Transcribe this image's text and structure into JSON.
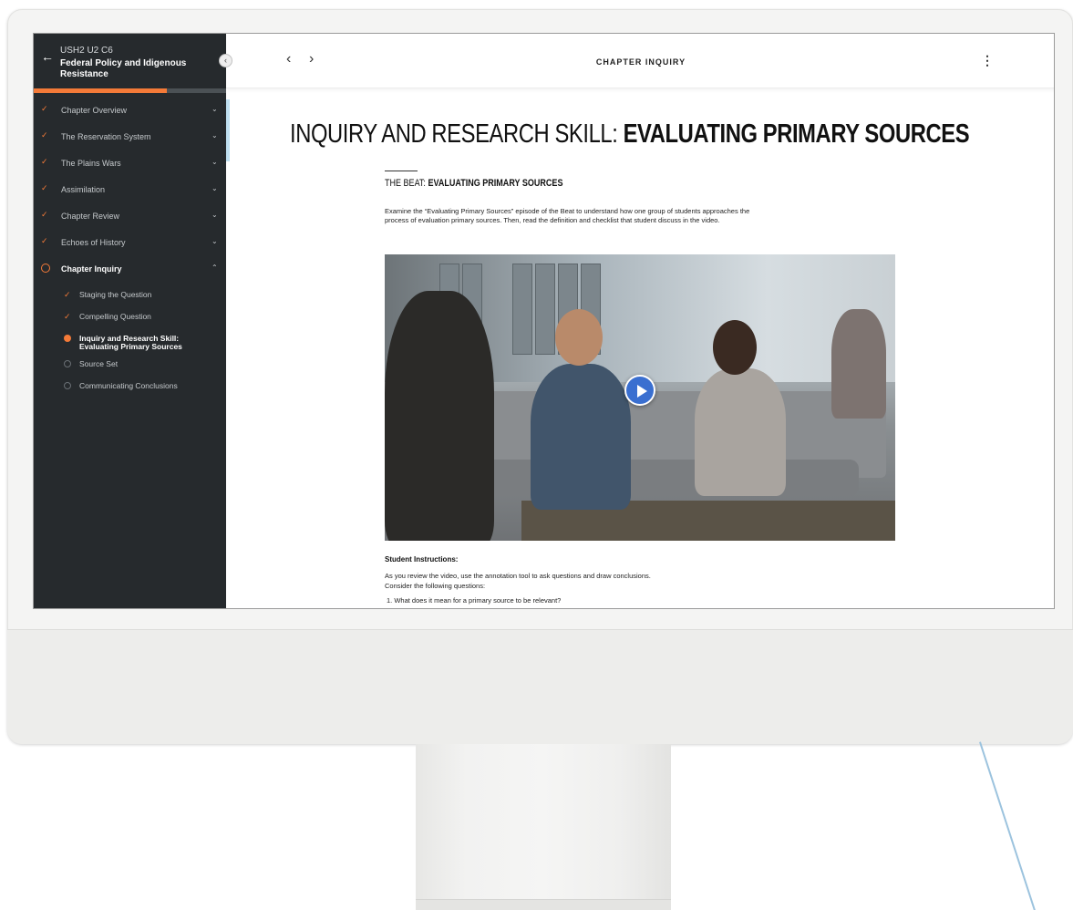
{
  "sidebar": {
    "course_code": "USH2 U2 C6",
    "course_title": "Federal Policy and Idigenous Resistance",
    "progress_percent": 69,
    "items": [
      {
        "label": "Chapter Overview",
        "status": "complete"
      },
      {
        "label": "The Reservation System",
        "status": "complete"
      },
      {
        "label": "The Plains Wars",
        "status": "complete"
      },
      {
        "label": "Assimilation",
        "status": "complete"
      },
      {
        "label": "Chapter Review",
        "status": "complete"
      },
      {
        "label": "Echoes of History",
        "status": "complete"
      },
      {
        "label": "Chapter Inquiry",
        "status": "in-progress"
      }
    ],
    "sub_items": [
      {
        "label": "Staging the Question",
        "status": "complete"
      },
      {
        "label": "Compelling Question",
        "status": "complete"
      },
      {
        "label": "Inquiry and Research Skill: Evaluating Primary Sources",
        "status": "current"
      },
      {
        "label": "Source Set",
        "status": "not-started"
      },
      {
        "label": "Communicating Conclusions",
        "status": "not-started"
      }
    ]
  },
  "topbar": {
    "title": "CHAPTER INQUIRY",
    "prev_icon": "chevron-left-icon",
    "next_icon": "chevron-right-icon",
    "menu_icon": "kebab-menu-icon"
  },
  "main": {
    "title_light": "INQUIRY AND RESEARCH SKILL: ",
    "title_bold": "EVALUATING PRIMARY SOURCES",
    "subtitle_light": "THE BEAT: ",
    "subtitle_bold": "EVALUATING PRIMARY SOURCES",
    "intro": "Examine the “Evaluating Primary Sources” episode of the Beat to understand how one group of students approaches the process of evaluation primary sources. Then, read the definition and checklist that student discuss in the video.",
    "instructions_heading": "Student Instructions:",
    "instructions_body": "As you review the video, use the annotation tool to ask questions and draw conclusions. Consider the following questions:",
    "question_1": "1. What does it mean for a primary source to be relevant?"
  },
  "colors": {
    "accent": "#f47a38",
    "sidebar_bg": "#262a2d",
    "play_button": "#3a6fd0"
  }
}
